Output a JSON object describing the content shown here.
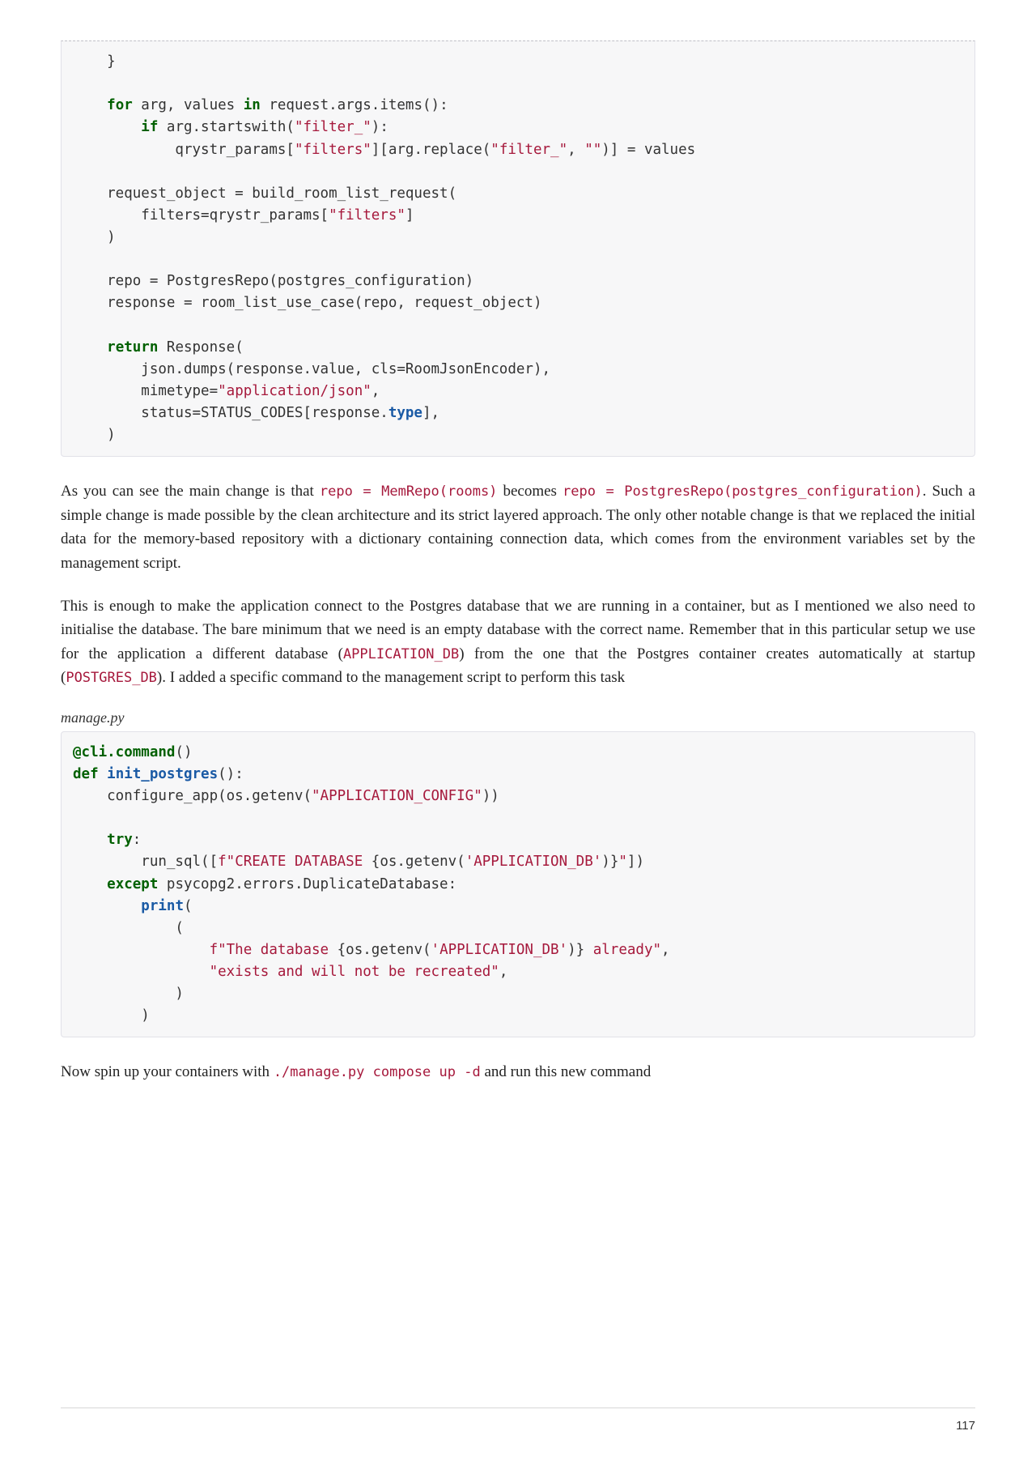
{
  "page_number": "117",
  "code_block_1": {
    "l01": "    }",
    "l02": "",
    "l03_pre": "    ",
    "l03_for": "for",
    "l03_mid": " arg, values ",
    "l03_in": "in",
    "l03_post": " request.args.items():",
    "l04_pre": "        ",
    "l04_if": "if",
    "l04_mid": " arg.startswith(",
    "l04_str": "\"filter_\"",
    "l04_post": "):",
    "l05_pre": "            qrystr_params[",
    "l05_s1": "\"filters\"",
    "l05_mid": "][arg.replace(",
    "l05_s2": "\"filter_\"",
    "l05_c": ", ",
    "l05_s3": "\"\"",
    "l05_post": ")] = values",
    "l06": "",
    "l07": "    request_object = build_room_list_request(",
    "l08_pre": "        filters=qrystr_params[",
    "l08_s": "\"filters\"",
    "l08_post": "]",
    "l09": "    )",
    "l10": "",
    "l11": "    repo = PostgresRepo(postgres_configuration)",
    "l12": "    response = room_list_use_case(repo, request_object)",
    "l13": "",
    "l14_pre": "    ",
    "l14_return": "return",
    "l14_post": " Response(",
    "l15": "        json.dumps(response.value, cls=RoomJsonEncoder),",
    "l16_pre": "        mimetype=",
    "l16_s": "\"application/json\"",
    "l16_post": ",",
    "l17_pre": "        status=STATUS_CODES[response.",
    "l17_type": "type",
    "l17_post": "],",
    "l18": "    )"
  },
  "para1": {
    "t1": "As you can see the main change is that ",
    "c1": "repo = MemRepo(rooms)",
    "t2": " becomes ",
    "c2": "repo = PostgresRepo(postgres_configuration)",
    "t3": ". Such a simple change is made possible by the clean architecture and its strict layered approach. The only other notable change is that we replaced the initial data for the memory-based repository with a dictionary containing connection data, which comes from the environment variables set by the management script."
  },
  "para2": {
    "t1": "This is enough to make the application connect to the Postgres database that we are running in a container, but as I mentioned we also need to initialise the database. The bare minimum that we need is an empty database with the correct name. Remember that in this particular setup we use for the application a different database (",
    "c1": "APPLICATION_DB",
    "t2": ") from the one that the Postgres container creates automatically at startup (",
    "c2": "POSTGRES_DB",
    "t3": "). I added a specific command to the management script to perform this task"
  },
  "caption": "manage.py",
  "code_block_2": {
    "l01_at": "@cli.command",
    "l01_post": "()",
    "l02_def": "def",
    "l02_sp": " ",
    "l02_fn": "init_postgres",
    "l02_post": "():",
    "l03_pre": "    configure_app(os.getenv(",
    "l03_s": "\"APPLICATION_CONFIG\"",
    "l03_post": "))",
    "l04": "",
    "l05_pre": "    ",
    "l05_try": "try",
    "l05_post": ":",
    "l06_pre": "        run_sql([",
    "l06_f": "f\"CREATE DATABASE ",
    "l06_br1": "{",
    "l06_expr": "os.getenv(",
    "l06_s2": "'APPLICATION_DB'",
    "l06_expr2": ")",
    "l06_br2": "}",
    "l06_fend": "\"",
    "l06_post": "])",
    "l07_pre": "    ",
    "l07_except": "except",
    "l07_post": " psycopg2.errors.DuplicateDatabase:",
    "l08_pre": "        ",
    "l08_print": "print",
    "l08_post": "(",
    "l09": "            (",
    "l10_pre": "                ",
    "l10_f": "f\"The database ",
    "l10_br1": "{",
    "l10_expr": "os.getenv(",
    "l10_s2": "'APPLICATION_DB'",
    "l10_expr2": ")",
    "l10_br2": "}",
    "l10_fend": " already\"",
    "l10_post": ",",
    "l11_pre": "                ",
    "l11_s": "\"exists and will not be recreated\"",
    "l11_post": ",",
    "l12": "            )",
    "l13": "        )"
  },
  "para3": {
    "t1": "Now spin up your containers with ",
    "c1": "./manage.py compose up -d",
    "t2": " and run this new command"
  }
}
